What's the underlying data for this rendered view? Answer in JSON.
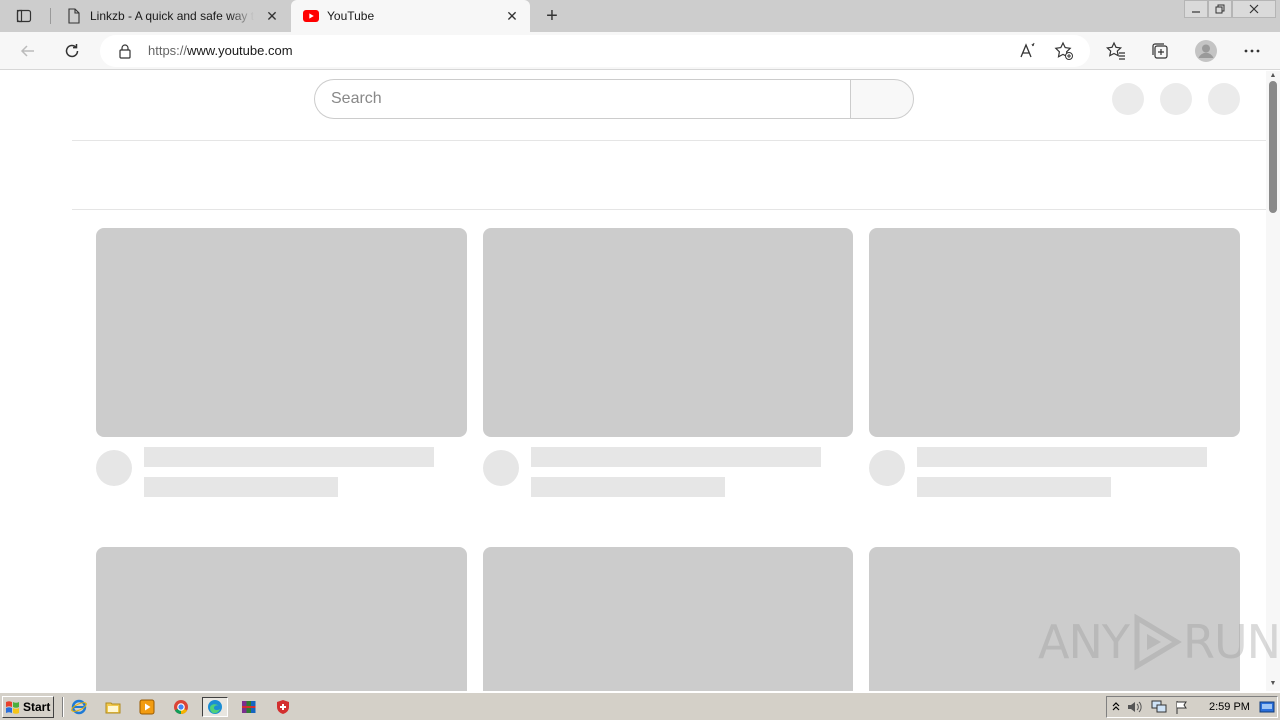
{
  "browser": {
    "tabs": [
      {
        "title": "Linkzb - A quick and safe way to",
        "active": false
      },
      {
        "title": "YouTube",
        "active": true
      }
    ],
    "url_scheme": "https://",
    "url_host": "www.youtube.com",
    "tab_close": "✕",
    "new_tab": "+"
  },
  "page": {
    "search_placeholder": "Search"
  },
  "watermark": {
    "left": "ANY",
    "right": "RUN"
  },
  "taskbar": {
    "start_label": "Start",
    "clock": "2:59 PM"
  },
  "colors": {
    "youtube_red": "#ff0000",
    "skeleton_thumb": "#cccccc",
    "skeleton_text": "#e6e6e6",
    "taskbar": "#d4d0c8"
  }
}
